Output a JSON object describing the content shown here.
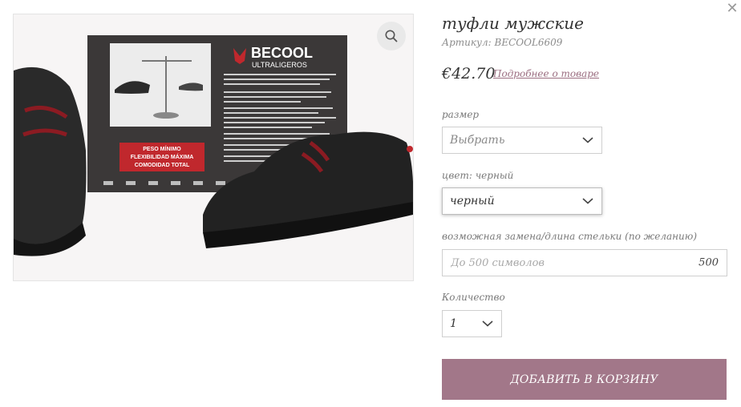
{
  "product": {
    "title": "туфли мужские",
    "sku": "Артикул: BECOOL6609",
    "price": "€42.70",
    "details_link": "Подробнее о товаре"
  },
  "image": {
    "brand": "BECOOL",
    "brand_sub": "ULTRALIGEROS",
    "banner_lines": [
      "PESO MÍNIMO",
      "FLEXIBILIDAD MÁXIMA",
      "COMODIDAD TOTAL"
    ],
    "accent_color": "#c0282d"
  },
  "options": {
    "size": {
      "label": "размер",
      "value": "Выбрать"
    },
    "color": {
      "label": "цвет: черный",
      "value": "черный"
    },
    "insole": {
      "label": "возможная замена/длина стельки (по желанию)",
      "placeholder": "До 500 символов",
      "counter": "500"
    },
    "quantity": {
      "label": "Количество",
      "value": "1"
    }
  },
  "actions": {
    "add_to_cart": "ДОБАВИТЬ В КОРЗИНУ"
  },
  "colors": {
    "accent": "#a27789",
    "link": "#9c6f82"
  }
}
